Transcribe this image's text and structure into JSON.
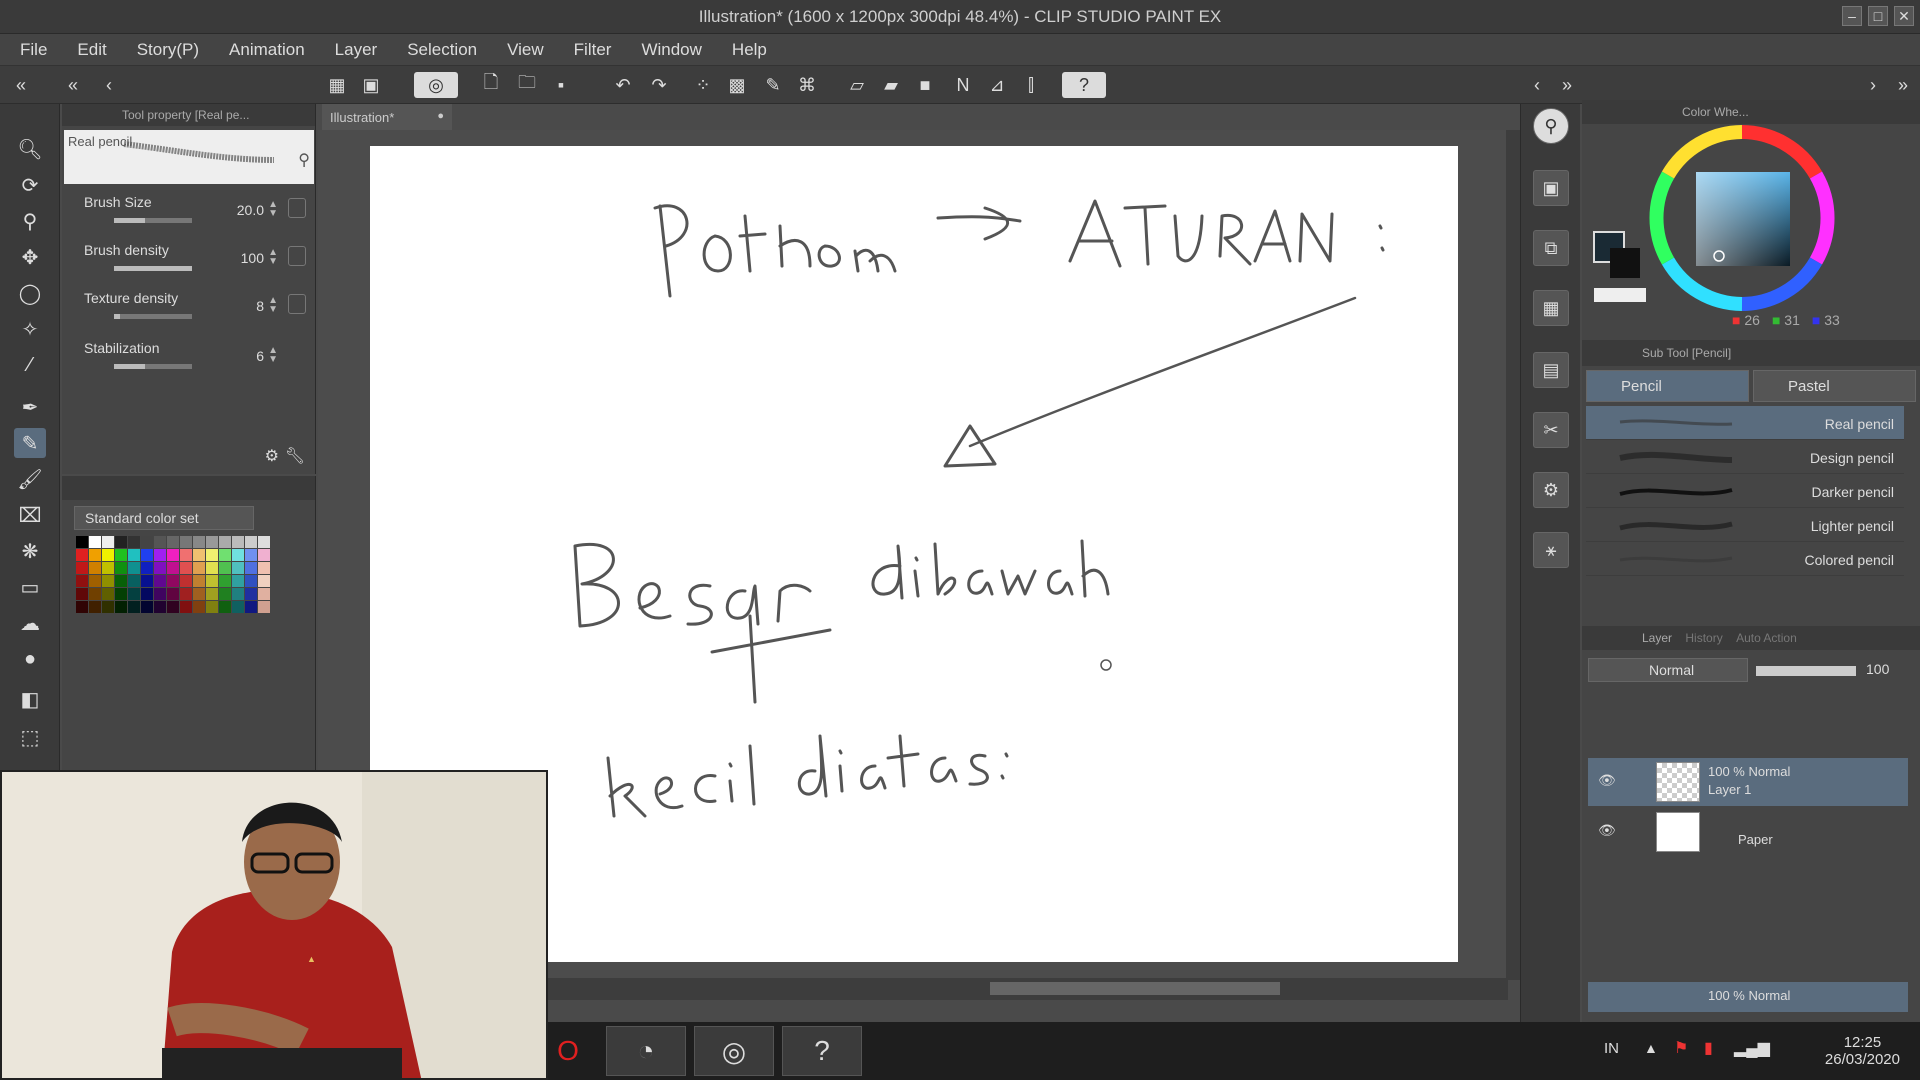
{
  "window": {
    "title": "Illustration* (1600 x 1200px 300dpi 48.4%) - CLIP STUDIO PAINT EX"
  },
  "menu": [
    "File",
    "Edit",
    "Story(P)",
    "Animation",
    "Layer",
    "Selection",
    "View",
    "Filter",
    "Window",
    "Help"
  ],
  "tool_property": {
    "header": "Tool property [Real pe...",
    "brush_name": "Real pencil",
    "props": [
      {
        "name": "Brush Size",
        "value": "20.0",
        "level": 0.4
      },
      {
        "name": "Brush density",
        "value": "100",
        "level": 1.0
      },
      {
        "name": "Texture density",
        "value": "8",
        "level": 0.08
      },
      {
        "name": "Stabilization",
        "value": "6",
        "level": 0.4
      }
    ]
  },
  "color_set": {
    "selected": "Standard color set"
  },
  "document": {
    "tab": "Illustration*"
  },
  "color_wheel": {
    "header": "Color Whe...",
    "r": "26",
    "g": "31",
    "b": "33"
  },
  "sub_tool": {
    "header": "Sub Tool [Pencil]",
    "tabs": [
      "Pencil",
      "Pastel"
    ],
    "brushes": [
      "Real pencil",
      "Design pencil",
      "Darker pencil",
      "Lighter pencil",
      "Colored pencil"
    ]
  },
  "layer_panel": {
    "tabs": [
      "Layer",
      "History",
      "Auto Action"
    ],
    "blend_mode": "Normal",
    "opacity": "100",
    "layers": [
      {
        "line1": "100 % Normal",
        "line2": "Layer 1"
      },
      {
        "line1": "",
        "line2": "Paper"
      }
    ],
    "bottom_layer": "100 % Normal"
  },
  "taskbar": {
    "lang": "IN",
    "time": "12:25",
    "date": "26/03/2020"
  },
  "colors": {
    "accent_selected": "#5a6c7e",
    "panel_bg": "#454545",
    "canvas_bg": "#4c4c4c"
  }
}
